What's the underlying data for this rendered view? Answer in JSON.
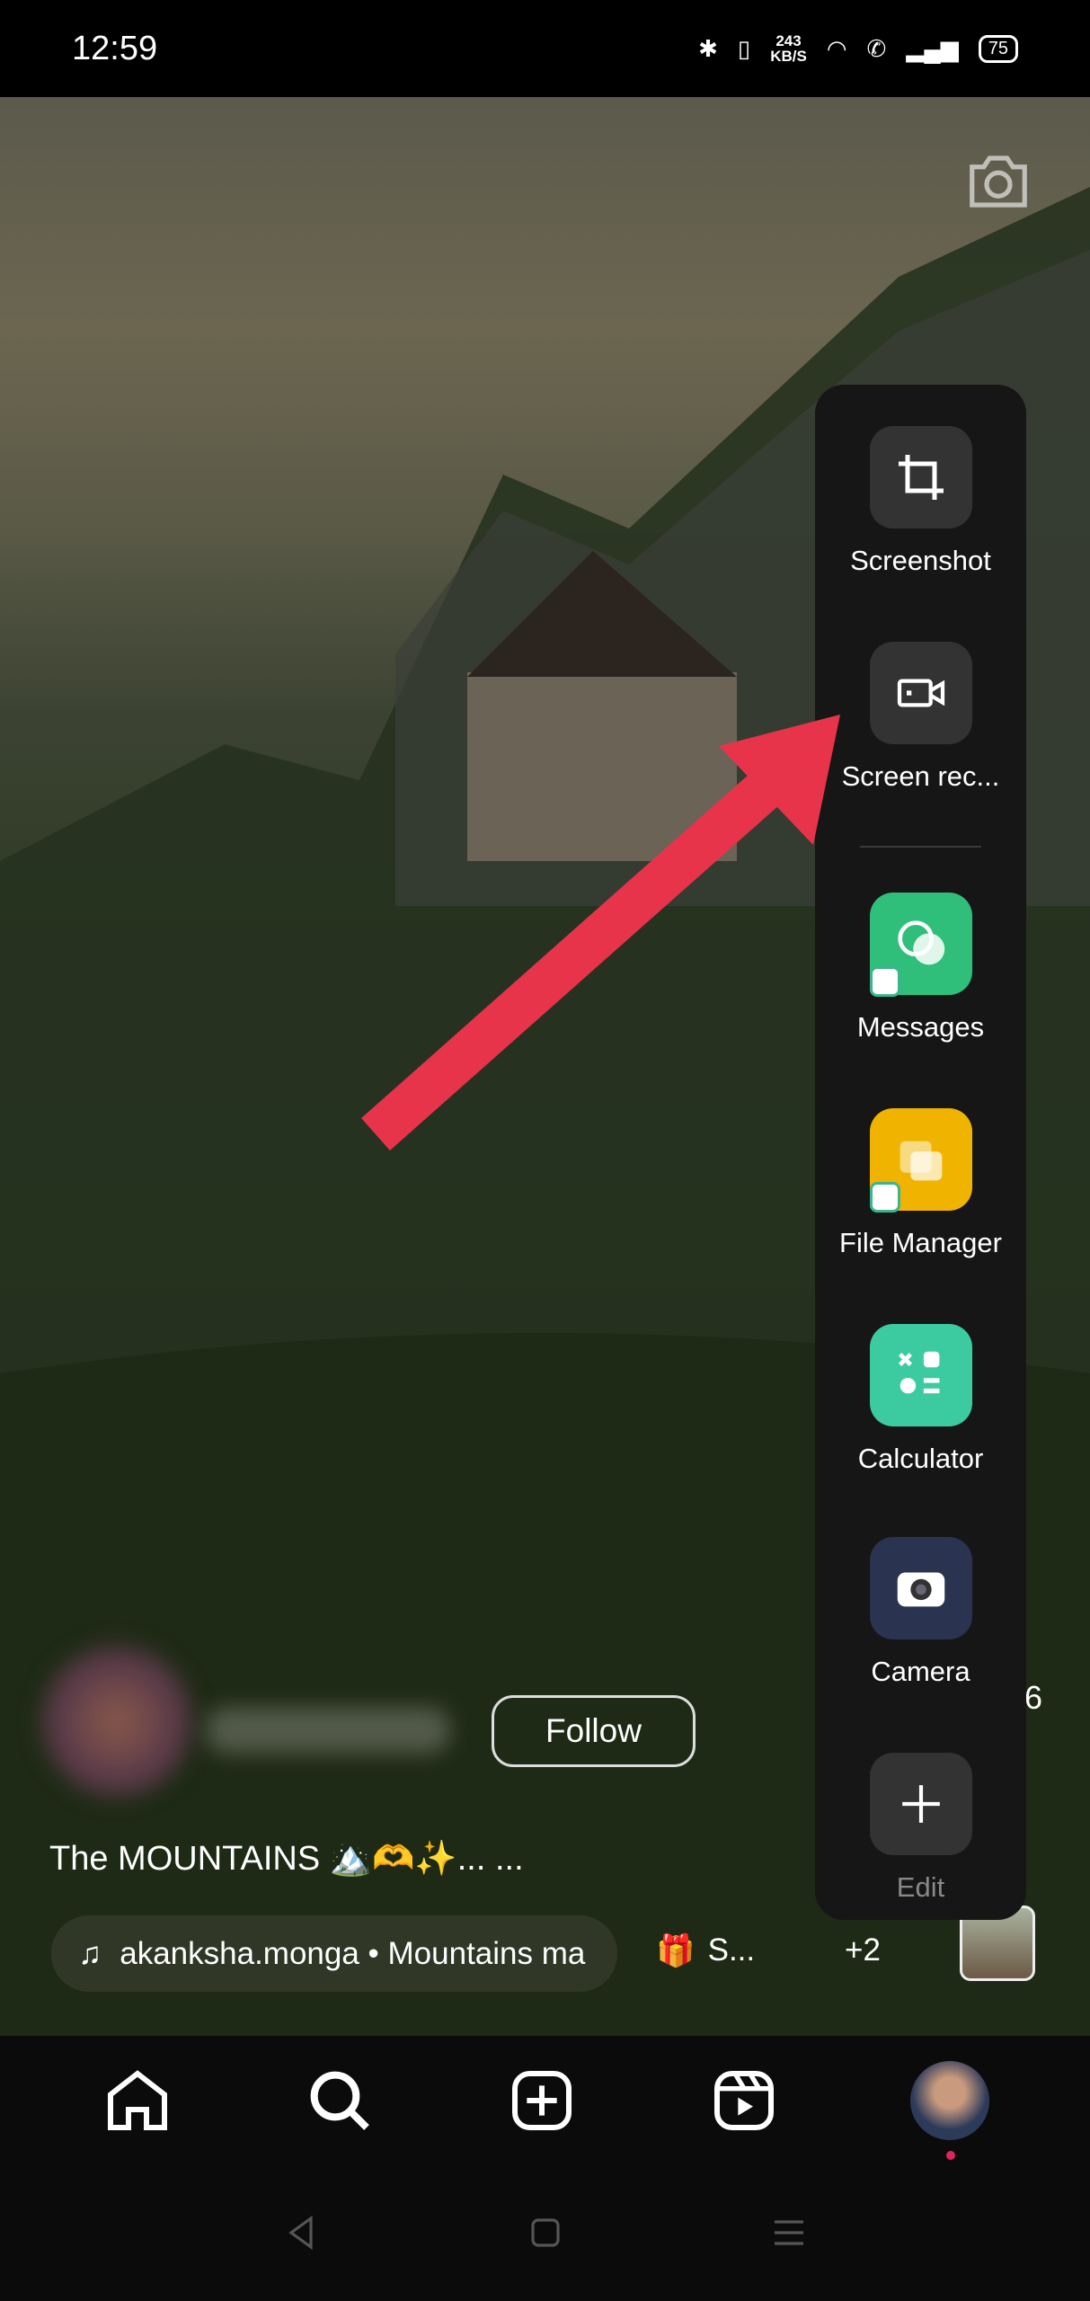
{
  "status_bar": {
    "time": "12:59",
    "net_speed_value": "243",
    "net_speed_unit": "KB/S",
    "battery": "75"
  },
  "reel": {
    "caption": "The MOUNTAINS 🏔️🫶✨... ...",
    "follow_label": "Follow",
    "music": "akanksha.monga • Mountains ma",
    "gift_label": "S...",
    "extra_count": "+2",
    "side_count": "6"
  },
  "smart_sidebar": {
    "items": [
      {
        "label": "Screenshot",
        "icon": "crop-icon"
      },
      {
        "label": "Screen rec...",
        "icon": "video-record-icon"
      },
      {
        "label": "Messages",
        "icon": "messages-icon",
        "color": "#2fbf7a"
      },
      {
        "label": "File Manager",
        "icon": "folder-icon",
        "color": "#f0b400"
      },
      {
        "label": "Calculator",
        "icon": "calculator-icon",
        "color": "#3ccba0"
      },
      {
        "label": "Camera",
        "icon": "camera-icon",
        "color": "#2a3350"
      },
      {
        "label": "Edit",
        "icon": "plus-icon"
      }
    ]
  },
  "annotation": {
    "arrow_color": "#e8344a"
  },
  "bottom_nav": [
    "home",
    "search",
    "create",
    "reels",
    "profile"
  ]
}
